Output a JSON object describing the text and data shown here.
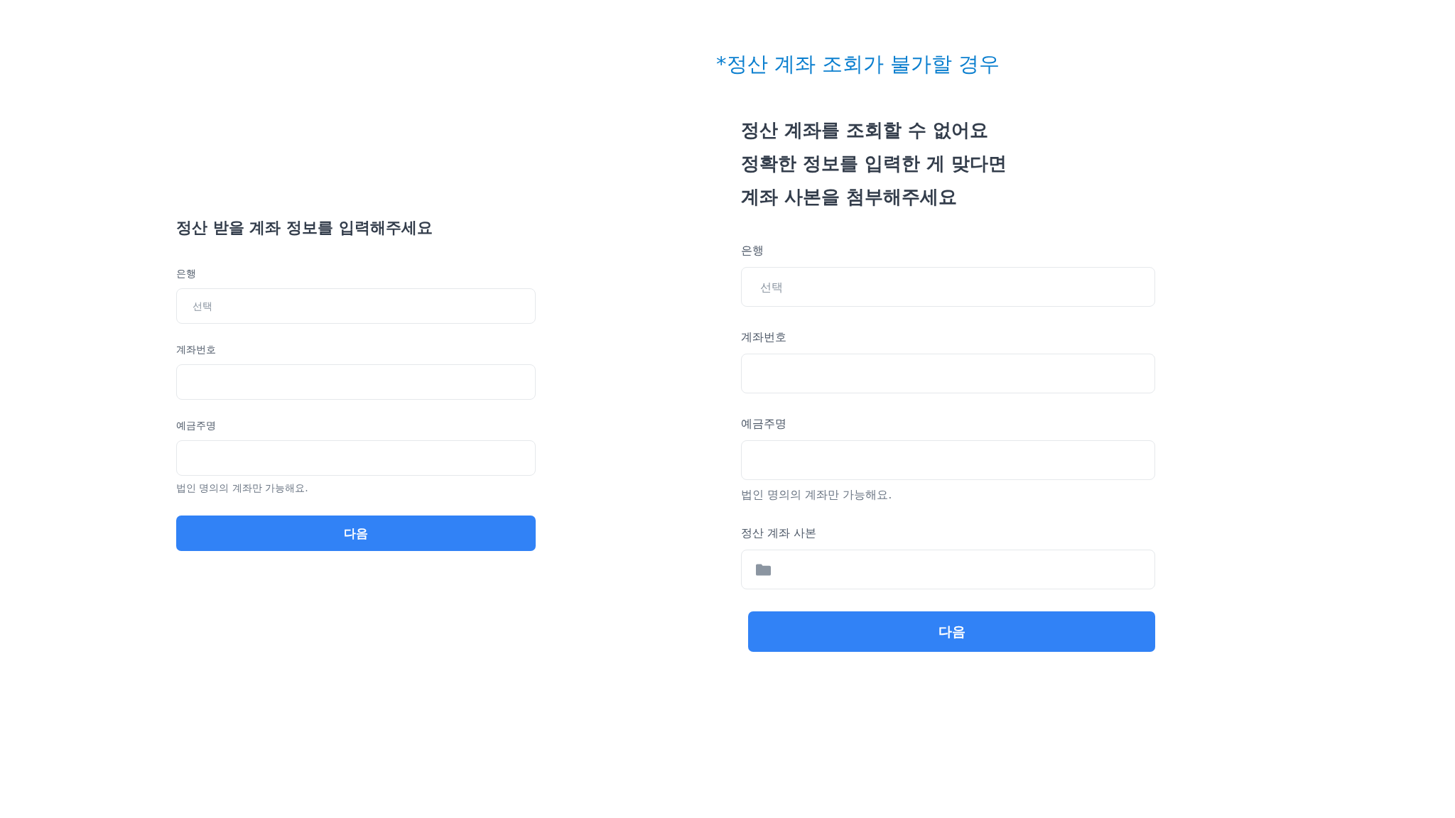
{
  "left_form": {
    "heading": "정산 받을 계좌 정보를 입력해주세요",
    "fields": [
      {
        "kind": "input",
        "label": "은행",
        "placeholder": "선택"
      },
      {
        "kind": "input",
        "label": "계좌번호"
      },
      {
        "kind": "input",
        "label": "예금주명",
        "hint": "법인 명의의 계좌만 가능해요."
      }
    ],
    "button": "다음"
  },
  "right_form": {
    "note": "*정산 계좌 조회가 불가할 경우",
    "heading": "정산 계좌를 조회할 수 없어요\n정확한 정보를 입력한 게 맞다면\n계좌 사본을 첨부해주세요",
    "fields": [
      {
        "kind": "input",
        "label": "은행",
        "placeholder": "선택"
      },
      {
        "kind": "input",
        "label": "계좌번호"
      },
      {
        "kind": "input",
        "label": "예금주명",
        "hint": "법인 명의의 계좌만 가능해요."
      },
      {
        "kind": "file",
        "label": "정산 계좌 사본"
      }
    ],
    "button": "다음"
  }
}
